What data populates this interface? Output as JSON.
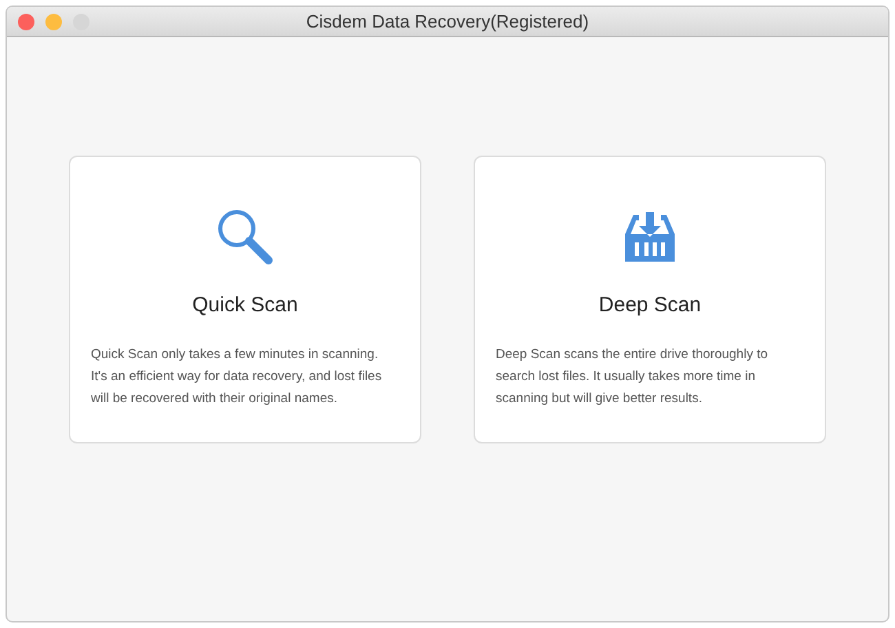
{
  "window": {
    "title": "Cisdem Data Recovery(Registered)",
    "controls": [
      {
        "color": "#fc605c"
      },
      {
        "color": "#fdbc40"
      },
      {
        "color": "#d6d6d6"
      }
    ]
  },
  "cards": [
    {
      "kind": "quick",
      "title": "Quick Scan",
      "description": "Quick Scan only takes a few minutes in scanning. It's an efficient way for data recovery, and lost files will be recovered with their original names."
    },
    {
      "kind": "deep",
      "title": "Deep Scan",
      "description": "Deep Scan scans the entire drive thoroughly to search lost files. It usually takes more time in scanning but will give better results."
    }
  ]
}
